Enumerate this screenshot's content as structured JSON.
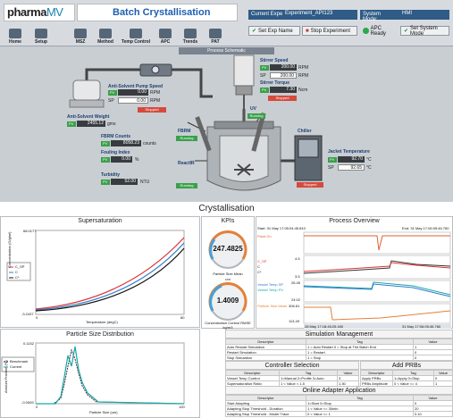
{
  "header": {
    "logo_part1": "pharma",
    "logo_part2": "MV",
    "title": "Batch Crystallisation",
    "current_experiment_label": "Current Experiment:",
    "current_experiment_value": "Experiment_API123",
    "system_mode_label": "System Mode:",
    "system_mode_value": "HMI",
    "set_exp_name": "Set Exp Name",
    "stop_experiment": "Stop Experiment",
    "apc_ready": "APC Ready",
    "set_system_mode": "Set System Mode",
    "nav": [
      "Home",
      "Setup",
      "MSZ",
      "Method",
      "Temp Control",
      "APC",
      "Trends",
      "PAT"
    ]
  },
  "schematic": {
    "title": "Process Schematic",
    "pump_label": "Anti-Solvent Pump Speed",
    "pump_pv": "0.00",
    "pump_sp": "0.00",
    "pump_unit": "RPM",
    "pump_status": "Stopped",
    "weight_label": "Anti-Solvent Weight",
    "weight_value": "2455.12",
    "weight_unit": "gms",
    "stirrer_speed_label": "Stirrer Speed",
    "stirrer_pv": "200.00",
    "stirrer_sp": "200.00",
    "stirrer_unit": "RPM",
    "stirrer_torque_label": "Stirrer Torque",
    "stirrer_torque": "7.30",
    "torque_unit": "Ncm",
    "stirrer_status": "Stopped",
    "uv_label": "UV",
    "fbrm_label": "FBRM",
    "fbrm_status": "Running",
    "fbrm_counts_label": "FBRM Counts",
    "fbrm_counts": "8058.23",
    "counts_unit": "counts",
    "fouling_label": "Fouling Index",
    "fouling_value": "0.00",
    "fouling_unit": "%",
    "turbidity_label": "Turbidity",
    "turbidity_value": "52.00",
    "turbidity_unit": "NTU",
    "reactir_label": "ReactIR",
    "reactir_status": "Running",
    "chiller_label": "Chiller",
    "jacket_label": "Jacket Temperature",
    "jacket_pv": "92.70",
    "jacket_sp": "92.65",
    "jacket_unit": "°C",
    "chiller_status": "Stopped",
    "pv": "PV",
    "sp": "SP"
  },
  "crystallisation": {
    "title": "Crystallisation",
    "supersat": {
      "title": "Supersaturation",
      "ylabel": "Concentration (G/g/ml)",
      "xlabel": "Temperature (degC)",
      "ymax": "68.0177",
      "ymin": "-3.2437",
      "xmin": "0",
      "xmax": "80",
      "legend": [
        "C_SP",
        "C",
        "C*"
      ]
    },
    "psd": {
      "title": "Particle Size Distribution",
      "ylabel": "Amount Fraction (%)",
      "xlabel": "Particle Size (um)",
      "ymax": "0.1152",
      "ymin": "-0.0009",
      "xmin": "0",
      "xmax": "100",
      "legend": [
        "Benchmark",
        "Current"
      ]
    },
    "kpis": {
      "title": "KPIs",
      "k1_value": "247.4825",
      "k1_label": "Particle Size Mean",
      "k1_unit": "um",
      "k2_value": "1.4009",
      "k2_label": "Concentration Control RMSE",
      "k2_unit": "kg/m3"
    },
    "overview": {
      "title": "Process Overview",
      "start": "Start: 31 May 17:05:04:45.810",
      "end": "End: 31 May 17:06:05:46.760",
      "t1": "Plant On",
      "t2_a": "C_SP",
      "t2_b": "C",
      "t2_c": "C*",
      "t3_a": "Vessel Temp SP",
      "t3_b": "Vessel Temp PV",
      "t4": "Particle Size Mean",
      "y2_top": "4.5",
      "y2_bot": "3.5",
      "y3_top": "26.45",
      "y3_bot": "24.02",
      "y4_top": "306.61",
      "y4_bot": "113.49",
      "ts_start": "28 May 17:18:45:25.400",
      "ts_end": "31 May 17:06:05:46.760"
    },
    "sim_mgmt": {
      "title": "Simulation Management",
      "headers": [
        "Descriptor",
        "Tag",
        "Value"
      ],
      "rows": [
        [
          "Auto Restart Simulation",
          "1 = Auto Restart 0 = Stop at The Batch End",
          "1"
        ],
        [
          "Restart Simulation",
          "1 = Restart",
          "0"
        ],
        [
          "Stop Simulation",
          "1 = Stop",
          "0"
        ]
      ]
    },
    "controller": {
      "title": "Controller Selection",
      "headers": [
        "Descriptor",
        "Tag",
        "Value"
      ],
      "rows": [
        [
          "Vessel Temp Control",
          "1=Manual 2=Profile 3=Auto",
          "3"
        ],
        [
          "Supersaturation Ratio",
          "1 < Value < 1.5",
          "1.30"
        ]
      ]
    },
    "add_prbs": {
      "title": "Add PRBs",
      "headers": [
        "Descriptor",
        "Tag",
        "Value"
      ],
      "rows": [
        [
          "Apply PRBs",
          "1=Apply 0=Stop",
          "0"
        ],
        [
          "PRBs Amplitude",
          "0 < Value <= 4",
          "1"
        ]
      ]
    },
    "online": {
      "title": "Online Adapter Application",
      "headers": [
        "Descriptor",
        "Tag",
        "Value"
      ],
      "rows": [
        [
          "Start Adapting",
          "1=Start 0=Stop",
          "0"
        ],
        [
          "Adapting Stop Threshold - Duration",
          "1 < Value <= 30min",
          "20"
        ],
        [
          "Adapting Stop Threshold - Model Trace",
          "0 < Value <= 1",
          "0.10"
        ]
      ]
    }
  }
}
